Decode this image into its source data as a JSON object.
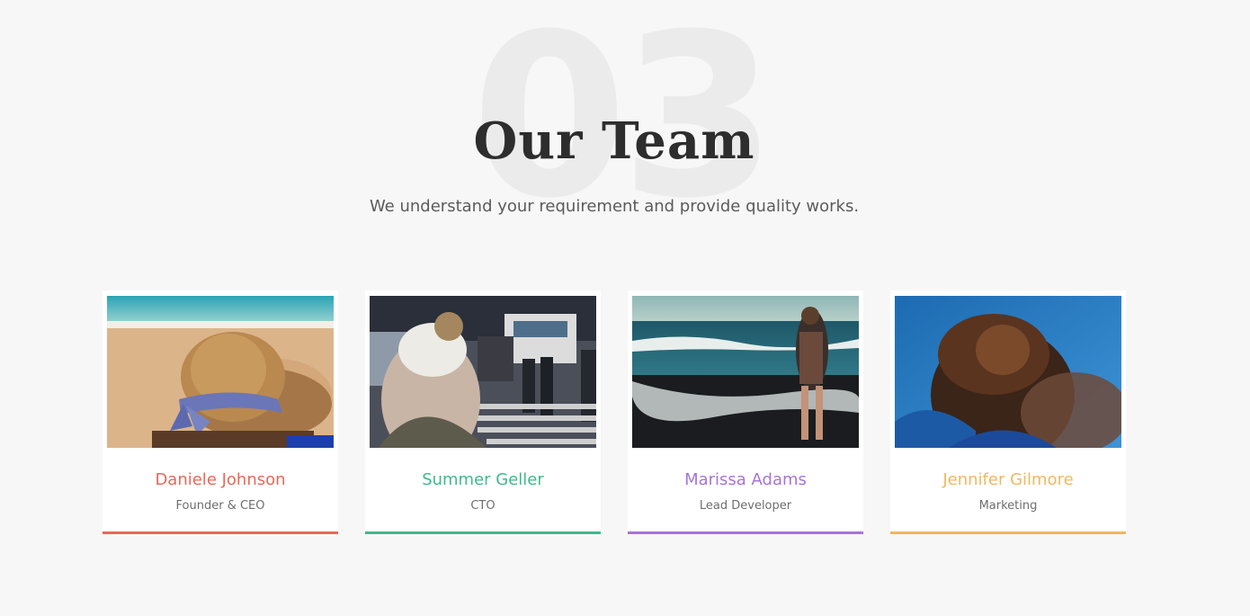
{
  "section": {
    "number": "03",
    "title": "Our Team",
    "subtitle": "We understand your requirement and provide quality works."
  },
  "team": [
    {
      "name": "Daniele Johnson",
      "role": "Founder & CEO",
      "accent": "#e8685a",
      "photo": "woman-straw-hat-beach"
    },
    {
      "name": "Summer Geller",
      "role": "CTO",
      "accent": "#3fba8c",
      "photo": "woman-beanie-city-street"
    },
    {
      "name": "Marissa Adams",
      "role": "Lead Developer",
      "accent": "#a874d6",
      "photo": "woman-walking-shoreline"
    },
    {
      "name": "Jennifer Gilmore",
      "role": "Marketing",
      "accent": "#f0b860",
      "photo": "woman-hair-bun-blue-sky"
    }
  ]
}
